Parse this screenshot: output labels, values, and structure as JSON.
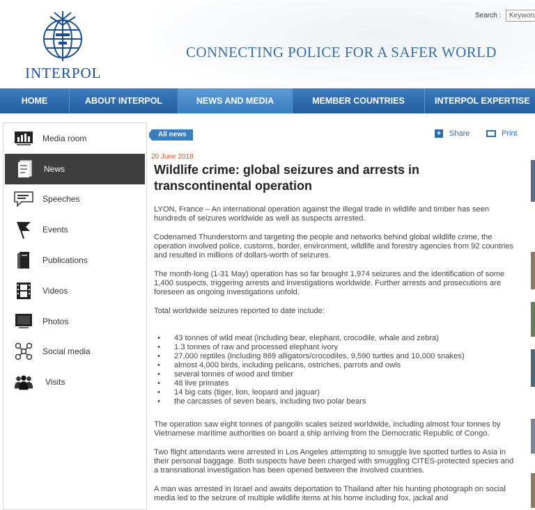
{
  "header": {
    "logo_text": "INTERPOL",
    "tagline": "CONNECTING POLICE FOR A SAFER WORLD",
    "search_label": "Search :",
    "search_value": "Keywords"
  },
  "nav": {
    "items": [
      {
        "label": "HOME"
      },
      {
        "label": "ABOUT INTERPOL"
      },
      {
        "label": "NEWS AND MEDIA"
      },
      {
        "label": "MEMBER COUNTRIES"
      },
      {
        "label": "INTERPOL EXPERTISE"
      }
    ],
    "active": "NEWS AND MEDIA"
  },
  "sidebar": {
    "items": [
      {
        "label": "Media room",
        "icon": "chart-icon"
      },
      {
        "label": "News",
        "icon": "document-icon"
      },
      {
        "label": "Speeches",
        "icon": "speech-icon"
      },
      {
        "label": "Events",
        "icon": "flag-icon"
      },
      {
        "label": "Publications",
        "icon": "book-icon"
      },
      {
        "label": "Videos",
        "icon": "film-icon"
      },
      {
        "label": "Photos",
        "icon": "monitor-icon"
      },
      {
        "label": "Social media",
        "icon": "network-icon"
      },
      {
        "label": "Visits",
        "icon": "people-icon"
      }
    ],
    "active": "News"
  },
  "toolbar": {
    "all_news": "All news",
    "share": "Share",
    "print": "Print"
  },
  "article": {
    "date": "20 June 2018",
    "title": "Wildlife crime: global seizures and arrests in transcontinental operation",
    "p1": "LYON, France – An international operation against the illegal trade in wildlife and timber has seen hundreds of seizures worldwide as well as suspects arrested.",
    "p2": "Codenamed Thunderstorm and targeting the people and networks behind global wildlife crime, the operation involved police, customs, border, environment, wildlife and forestry agencies from 92 countries and resulted in millions of dollars-worth of seizures.",
    "p3": "The month-long (1-31 May) operation has so far brought 1,974 seizures and the identification of some 1,400 suspects, triggering arrests and investigations worldwide. Further arrests and prosecutions are foreseen as ongoing investigations unfold.",
    "p4": "Total worldwide seizures reported to date include:",
    "list": [
      "43 tonnes of wild meat (including bear, elephant, crocodile, whale and zebra)",
      "1.3 tonnes of raw and processed elephant ivory",
      "27,000 reptiles (including 869 alligators/crocodiles, 9,590 turtles and 10,000 snakes)",
      "almost 4,000 birds, including pelicans, ostriches, parrots and owls",
      "several tonnes of wood and timber",
      "48 live primates",
      "14 big cats (tiger, lion, leopard and jaguar)",
      "the carcasses of seven bears, including two polar bears"
    ],
    "p5": "The operation saw eight tonnes of pangolin scales seized worldwide, including almost four tonnes by Vietnamese maritime authorities on board a ship arriving from the Democratic Republic of Congo.",
    "p6": "Two flight attendants were arrested in Los Angeles attempting to smuggle live spotted turtles to Asia in their personal baggage. Both suspects have been charged with smuggling CITES-protected species and a transnational investigation has been opened between the involved countries.",
    "p7": "A man was arrested in Israel and awaits deportation to Thailand after his hunting photograph on social media led to the seizure of multiple wildlife items at his home including fox, jackal and"
  },
  "colors": {
    "nav": "#2f6fb0",
    "nav_active": "#4a8ccc",
    "accent_date": "#d9541e",
    "link": "#2a6bb0",
    "sidebar_active": "#3e3e3e"
  }
}
